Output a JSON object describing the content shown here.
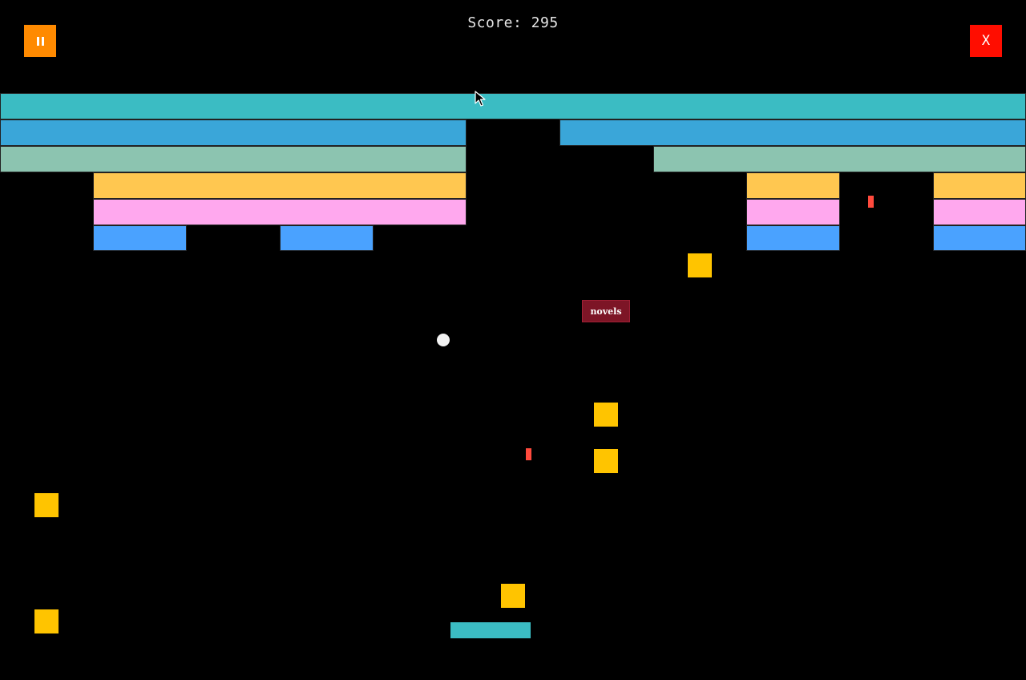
{
  "hud": {
    "score_text": "Score: 295",
    "pause_icon": "pause-icon",
    "close_label": "X"
  },
  "colors": {
    "background": "#000000",
    "pause_button": "#ff8a00",
    "close_button": "#ff0d00",
    "brick_teal": "#3bbcc3",
    "brick_sky": "#3aa6d9",
    "brick_sage": "#8cc4b0",
    "brick_gold": "#ffc750",
    "brick_pink": "#ffa8ee",
    "brick_blue": "#4aa2ff",
    "powerup": "#ffc400",
    "laser": "#ff4a3d",
    "ball": "#f2f2f2",
    "paddle": "#3bbcc3",
    "word_tag": "#7d1526"
  },
  "word_tag": {
    "text": "novels"
  },
  "icons": {
    "cursor": "mouse-pointer-icon"
  }
}
